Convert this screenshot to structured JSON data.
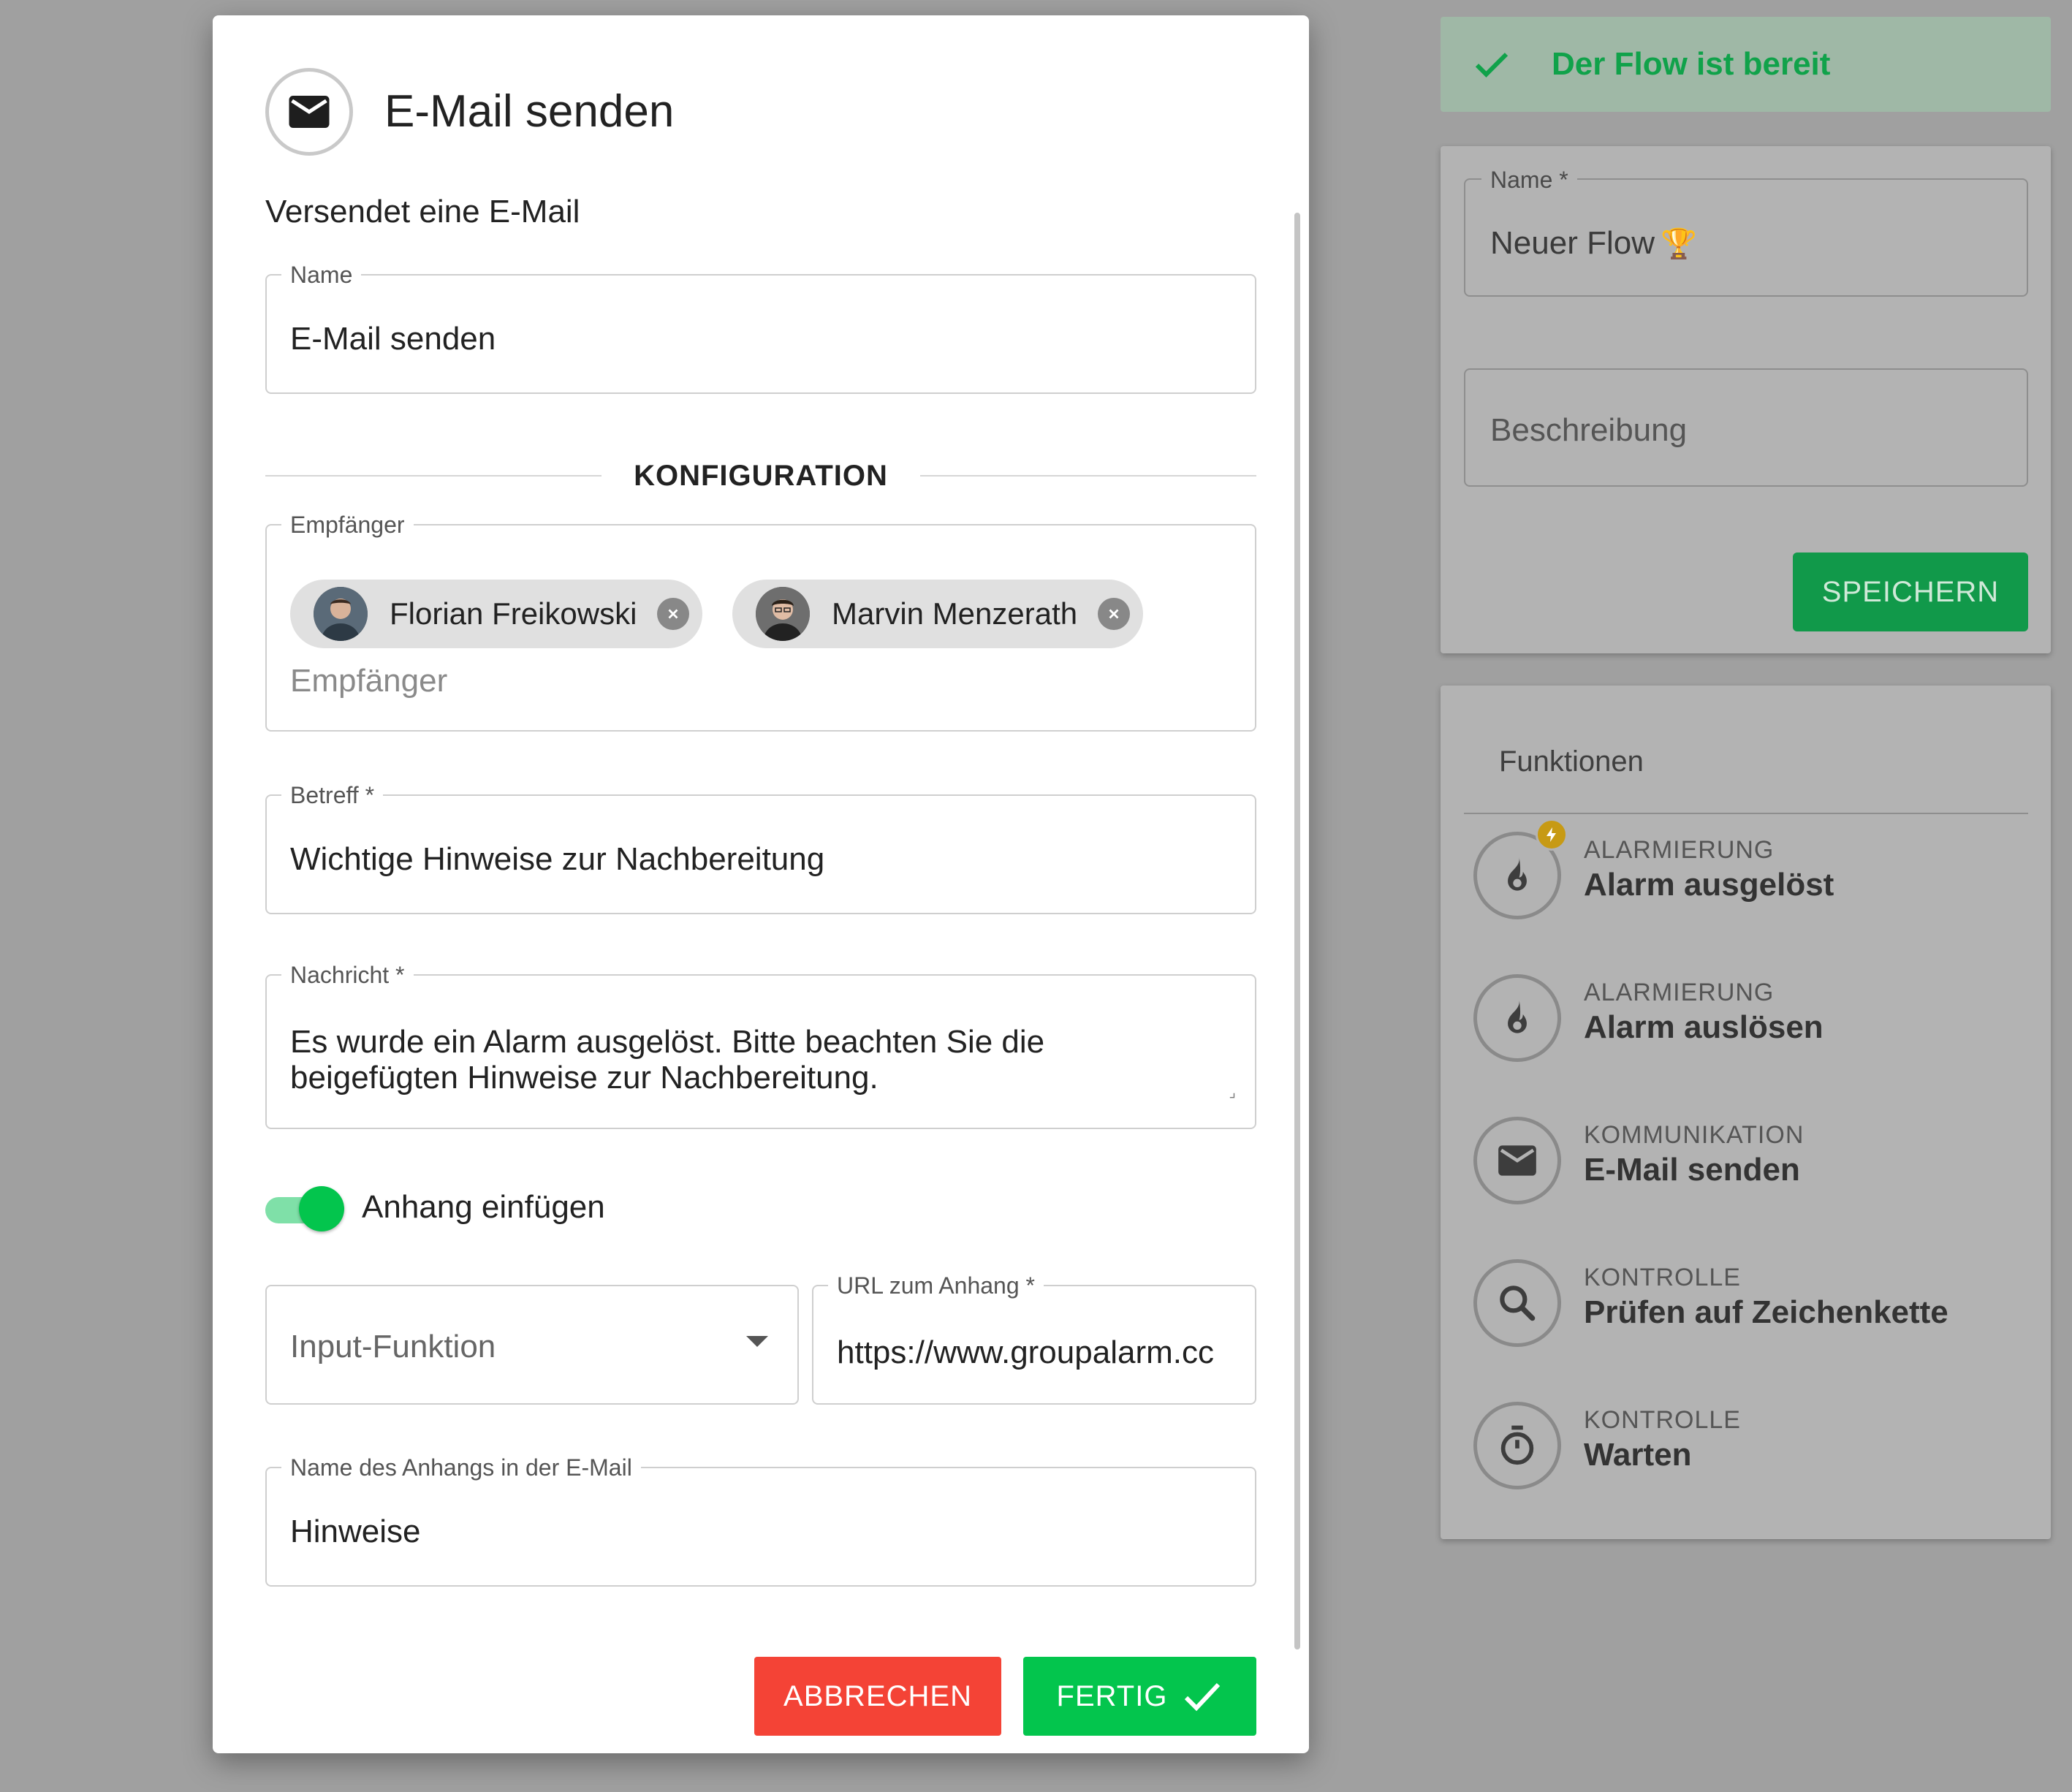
{
  "toast": {
    "text": "Der Flow ist bereit",
    "icon": "check-icon"
  },
  "flow_form": {
    "name_label": "Name *",
    "name_value": "Neuer Flow",
    "name_emoji": "🏆",
    "description_placeholder": "Beschreibung",
    "save_label": "SPEICHERN"
  },
  "functions": {
    "title": "Funktionen",
    "items": [
      {
        "category": "ALARMIERUNG",
        "name": "Alarm ausgelöst",
        "icon": "flame-icon",
        "badge": "bolt-icon"
      },
      {
        "category": "ALARMIERUNG",
        "name": "Alarm auslösen",
        "icon": "flame-icon"
      },
      {
        "category": "KOMMUNIKATION",
        "name": "E-Mail senden",
        "icon": "mail-icon"
      },
      {
        "category": "KONTROLLE",
        "name": "Prüfen auf Zeichenkette",
        "icon": "search-icon"
      },
      {
        "category": "KONTROLLE",
        "name": "Warten",
        "icon": "timer-icon"
      }
    ]
  },
  "modal": {
    "title": "E-Mail senden",
    "description": "Versendet eine E-Mail",
    "name_field": {
      "label": "Name",
      "value": "E-Mail senden"
    },
    "section_title": "KONFIGURATION",
    "recipients": {
      "label": "Empfänger",
      "placeholder": "Empfänger",
      "chips": [
        {
          "name": "Florian Freikowski"
        },
        {
          "name": "Marvin Menzerath"
        }
      ]
    },
    "subject": {
      "label": "Betreff *",
      "value": "Wichtige Hinweise zur Nachbereitung"
    },
    "message": {
      "label": "Nachricht *",
      "line1": "Es wurde ein Alarm ausgelöst. Bitte beachten Sie die",
      "line2": "beigefügten Hinweise zur Nachbereitung."
    },
    "attachment_toggle": {
      "label": "Anhang einfügen",
      "checked": true
    },
    "input_function": {
      "placeholder": "Input-Funktion"
    },
    "attachment_url": {
      "label": "URL zum Anhang *",
      "value": "https://www.groupalarm.cc"
    },
    "attachment_name": {
      "label": "Name des Anhangs in der E-Mail",
      "value": "Hinweise"
    },
    "cancel_label": "ABBRECHEN",
    "done_label": "FERTIG"
  },
  "colors": {
    "accent_green": "#03c54d",
    "cancel_red": "#f44336",
    "save_green": "#11994a"
  }
}
